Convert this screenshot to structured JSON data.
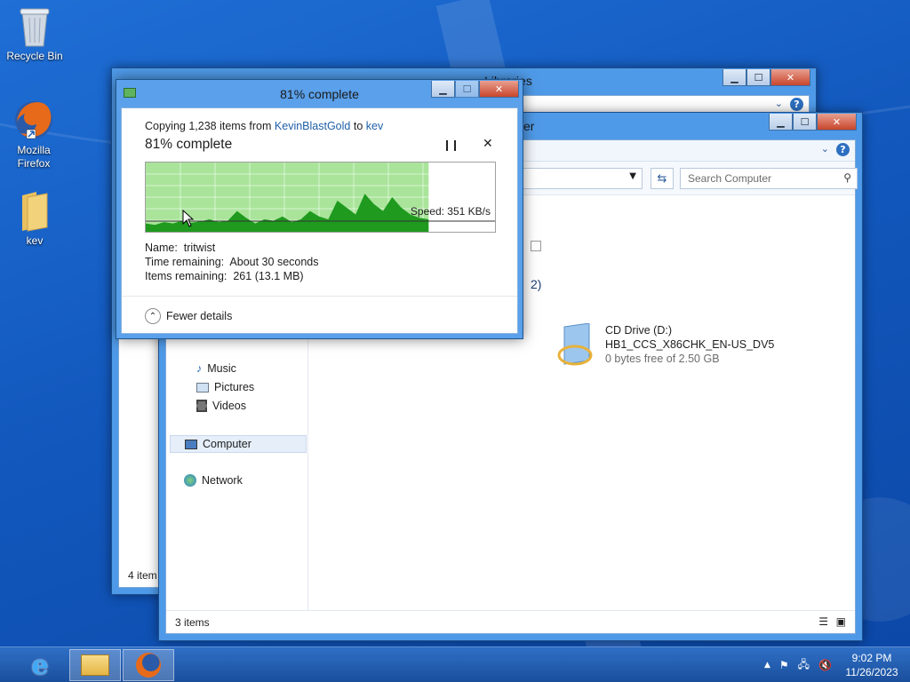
{
  "desktop": {
    "icons": [
      {
        "label": "Recycle Bin"
      },
      {
        "label": "Mozilla Firefox"
      },
      {
        "label": "kev"
      }
    ]
  },
  "libraries_window": {
    "title": "Libraries",
    "status": "4 item"
  },
  "explorer": {
    "title_fragment": "er",
    "search_placeholder": "Search Computer",
    "group_fragment": "2)",
    "nav": {
      "music": "Music",
      "pictures": "Pictures",
      "videos": "Videos",
      "computer": "Computer",
      "network": "Network"
    },
    "drive": {
      "name": "CD Drive (D:)",
      "label": "HB1_CCS_X86CHK_EN-US_DV5",
      "space": "0 bytes free of 2.50 GB"
    },
    "status": "3 items"
  },
  "copy_dialog": {
    "title": "81% complete",
    "line_prefix": "Copying 1,238 items from ",
    "source": "KevinBlastGold",
    "line_mid": " to ",
    "destination": "kev",
    "percent_label": "81% complete",
    "progress": 0.81,
    "speed": "Speed: 351 KB/s",
    "name_label": "Name:",
    "name_value": "tritwist",
    "time_label": "Time remaining:",
    "time_value": "About 30 seconds",
    "items_label": "Items remaining:",
    "items_value": "261 (13.1 MB)",
    "fewer_details": "Fewer details"
  },
  "taskbar": {
    "time": "9:02 PM",
    "date": "11/26/2023"
  }
}
